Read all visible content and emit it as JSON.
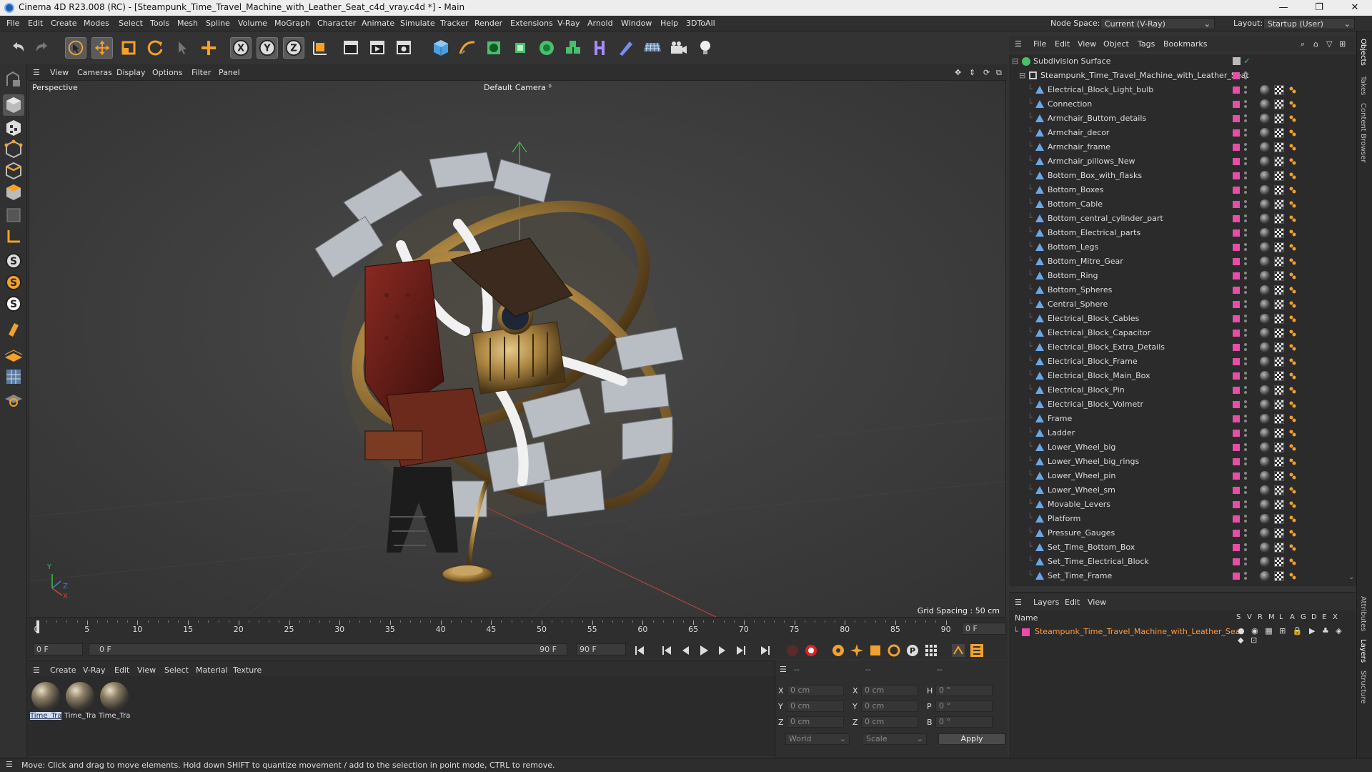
{
  "window": {
    "title": "Cinema 4D R23.008 (RC) - [Steampunk_Time_Travel_Machine_with_Leather_Seat_c4d_vray.c4d *] - Main",
    "controls": [
      "—",
      "❐",
      "✕"
    ]
  },
  "menubar": {
    "items": [
      "File",
      "Edit",
      "Create",
      "Modes",
      "Select",
      "Tools",
      "Mesh",
      "Spline",
      "Volume",
      "MoGraph",
      "Character",
      "Animate",
      "Simulate",
      "Tracker",
      "Render",
      "Extensions",
      "V-Ray",
      "Arnold",
      "Window",
      "Help",
      "3DToAll"
    ],
    "node_space_label": "Node Space:",
    "node_space_value": "Current (V-Ray)",
    "layout_label": "Layout:",
    "layout_value": "Startup (User)"
  },
  "viewport": {
    "menu": [
      "View",
      "Cameras",
      "Display",
      "Options",
      "Filter",
      "Panel"
    ],
    "name": "Perspective",
    "camera": "Default Camera",
    "grid_spacing": "Grid Spacing : 50 cm",
    "axis_y": "Y",
    "axis_z": "Z",
    "axis_x": "X"
  },
  "timeline": {
    "ticks": [
      "0",
      "5",
      "10",
      "15",
      "20",
      "25",
      "30",
      "35",
      "40",
      "45",
      "50",
      "55",
      "60",
      "65",
      "70",
      "75",
      "80",
      "85",
      "90"
    ],
    "current_frame": "0 F",
    "start": "0 F",
    "range_start": "0 F",
    "range_end": "90 F",
    "end": "90 F"
  },
  "material_manager": {
    "menu": [
      "Create",
      "V-Ray",
      "Edit",
      "View",
      "Select",
      "Material",
      "Texture"
    ],
    "materials": [
      "Time_Tra",
      "Time_Tra",
      "Time_Tra"
    ]
  },
  "coordinates": {
    "headers": [
      "--",
      "--",
      "--"
    ],
    "rows": [
      {
        "a": "X",
        "av": "0 cm",
        "b": "X",
        "bv": "0 cm",
        "c": "H",
        "cv": "0 °"
      },
      {
        "a": "Y",
        "av": "0 cm",
        "b": "Y",
        "bv": "0 cm",
        "c": "P",
        "cv": "0 °"
      },
      {
        "a": "Z",
        "av": "0 cm",
        "b": "Z",
        "bv": "0 cm",
        "c": "B",
        "cv": "0 °"
      }
    ],
    "space": "World",
    "mode": "Scale",
    "apply": "Apply"
  },
  "object_manager": {
    "menu": [
      "File",
      "Edit",
      "View",
      "Object",
      "Tags",
      "Bookmarks"
    ],
    "root": "Subdivision Surface",
    "parent": "Steampunk_Time_Travel_Machine_with_Leather_Seat",
    "children": [
      "Electrical_Block_Light_bulb",
      "Connection",
      "Armchair_Buttom_details",
      "Armchair_decor",
      "Armchair_frame",
      "Armchair_pillows_New",
      "Bottom_Box_with_flasks",
      "Bottom_Boxes",
      "Bottom_Cable",
      "Bottom_central_cylinder_part",
      "Bottom_Electrical_parts",
      "Bottom_Legs",
      "Bottom_Mitre_Gear",
      "Bottom_Ring",
      "Bottom_Spheres",
      "Central_Sphere",
      "Electrical_Block_Cables",
      "Electrical_Block_Capacitor",
      "Electrical_Block_Extra_Details",
      "Electrical_Block_Frame",
      "Electrical_Block_Main_Box",
      "Electrical_Block_Pin",
      "Electrical_Block_Volmetr",
      "Frame",
      "Ladder",
      "Lower_Wheel_big",
      "Lower_Wheel_big_rings",
      "Lower_Wheel_pin",
      "Lower_Wheel_sm",
      "Movable_Levers",
      "Platform",
      "Pressure_Gauges",
      "Set_Time_Bottom_Box",
      "Set_Time_Electrical_Block",
      "Set_Time_Frame"
    ]
  },
  "layers": {
    "menu": [
      "Layers",
      "Edit",
      "View"
    ],
    "col_name": "Name",
    "cols": [
      "S",
      "V",
      "R",
      "M",
      "L",
      "A",
      "G",
      "D",
      "E",
      "X"
    ],
    "layer_name": "Steampunk_Time_Travel_Machine_with_Leather_Seat",
    "layer_color": "#e64ea8"
  },
  "right_tabs": [
    "Objects",
    "Takes",
    "Content Browser",
    "Attributes",
    "Layers",
    "Structure"
  ],
  "status": "Move: Click and drag to move elements. Hold down SHIFT to quantize movement / add to the selection in point mode, CTRL to remove.",
  "colors": {
    "accent": "#e64ea8",
    "selection": "#5a5a5a",
    "highlight_text": "#ff9a3c"
  }
}
